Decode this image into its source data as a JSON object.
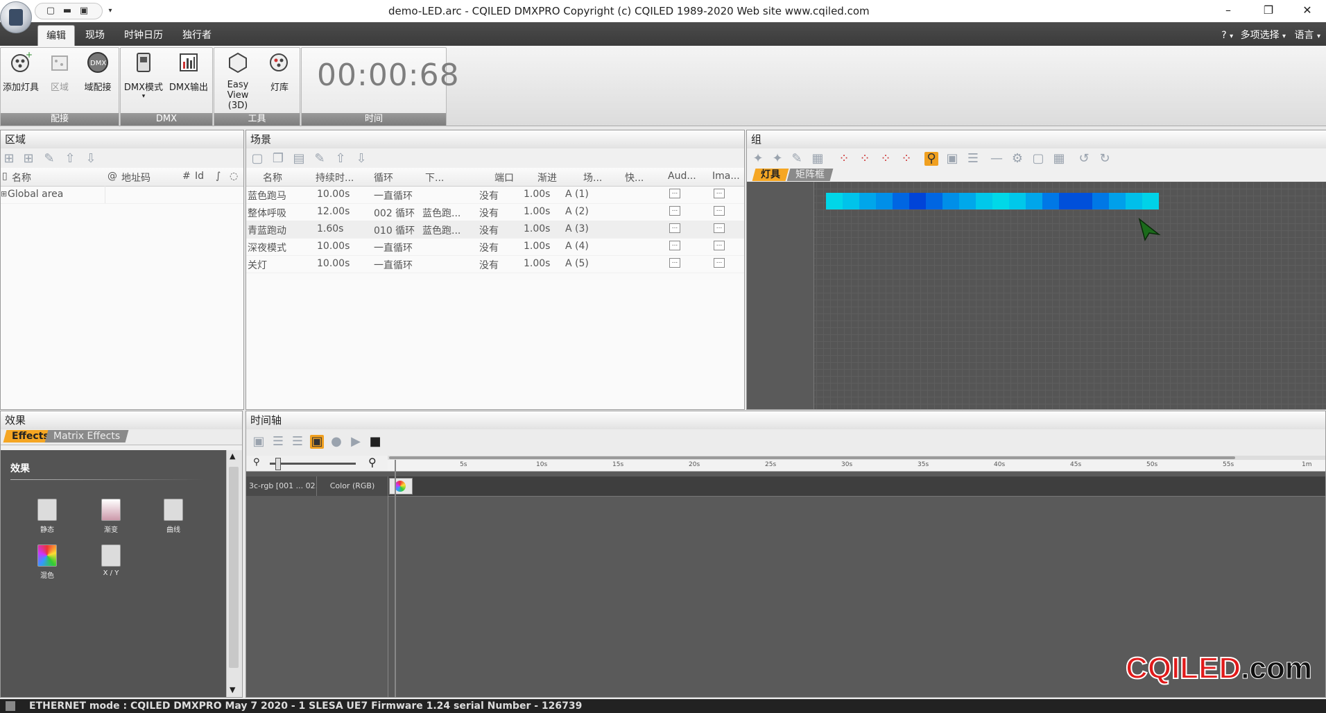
{
  "window": {
    "title": "demo-LED.arc - CQILED DMXPRO    Copyright (c) CQILED 1989-2020    Web site www.cqiled.com",
    "minimize": "–",
    "restore": "❐",
    "close": "✕"
  },
  "menu": {
    "tabs": [
      "编辑",
      "现场",
      "时钟日历",
      "独行者"
    ],
    "help": "?",
    "multi_select": "多项选择",
    "language": "语言"
  },
  "ribbon": {
    "groups": [
      {
        "title": "配接",
        "buttons": [
          "添加灯具",
          "区域",
          "域配接"
        ]
      },
      {
        "title": "DMX",
        "buttons": [
          "DMX模式",
          "DMX输出"
        ]
      },
      {
        "title": "工具",
        "buttons": [
          "Easy View\n(3D)",
          "灯库"
        ]
      },
      {
        "title": "时间",
        "buttons": []
      }
    ],
    "timer": "00:00:68",
    "dmx_mode_arrow": "▾"
  },
  "zone_panel": {
    "title": "区域",
    "columns": [
      "名称",
      "地址码",
      "Id"
    ],
    "col_prefix": [
      "@",
      "#"
    ],
    "rows": [
      {
        "name": "Global area"
      }
    ]
  },
  "scene_panel": {
    "title": "场景",
    "columns": [
      "名称",
      "持续时...",
      "循环",
      "下...",
      "端口",
      "渐进",
      "场...",
      "快...",
      "Aud...",
      "Ima..."
    ],
    "rows": [
      {
        "name": "蓝色跑马",
        "duration": "10.00s",
        "loop": "一直循环",
        "next": "",
        "port": "没有",
        "fade": "1.00s",
        "field": "A (1)"
      },
      {
        "name": "整体呼吸",
        "duration": "12.00s",
        "loop": "002 循环",
        "next": "蓝色跑...",
        "port": "没有",
        "fade": "1.00s",
        "field": "A (2)"
      },
      {
        "name": "青蓝跑动",
        "duration": "1.60s",
        "loop": "010 循环",
        "next": "蓝色跑...",
        "port": "没有",
        "fade": "1.00s",
        "field": "A (3)"
      },
      {
        "name": "深夜模式",
        "duration": "10.00s",
        "loop": "一直循环",
        "next": "",
        "port": "没有",
        "fade": "1.00s",
        "field": "A (4)"
      },
      {
        "name": "关灯",
        "duration": "10.00s",
        "loop": "一直循环",
        "next": "",
        "port": "没有",
        "fade": "1.00s",
        "field": "A (5)"
      }
    ],
    "dots": "..."
  },
  "group_panel": {
    "title": "组",
    "tabs": [
      "灯具",
      "矩阵框"
    ],
    "led_colors": [
      "#00d6e8",
      "#00c3ea",
      "#00a6ea",
      "#008fe8",
      "#0066e2",
      "#0044d8",
      "#0066e2",
      "#008fe8",
      "#00a8ea",
      "#00c8ea",
      "#00d8e8",
      "#00c8ea",
      "#00a6ea",
      "#0078e6",
      "#0050da",
      "#0050da",
      "#0078e6",
      "#00a0ea",
      "#00bfea",
      "#00d2e8"
    ]
  },
  "effects_panel": {
    "title": "效果",
    "tabs": [
      "Effects",
      "Matrix Effects"
    ],
    "section": "效果",
    "items": [
      "静态",
      "渐变",
      "曲线",
      "混色",
      "X / Y"
    ]
  },
  "timeline_panel": {
    "title": "时间轴",
    "ticks": [
      "5s",
      "10s",
      "15s",
      "20s",
      "25s",
      "30s",
      "35s",
      "40s",
      "45s",
      "50s",
      "55s",
      "1m"
    ],
    "track_name": "3c-rgb [001 ... 02...",
    "track_type": "Color (RGB)"
  },
  "status": {
    "text": "ETHERNET mode : CQILED DMXPRO May  7 2020 - 1 SLESA UE7 Firmware 1.24 serial Number  - 126739"
  },
  "logo": {
    "part1": "CQILED",
    "part2": ".com"
  }
}
